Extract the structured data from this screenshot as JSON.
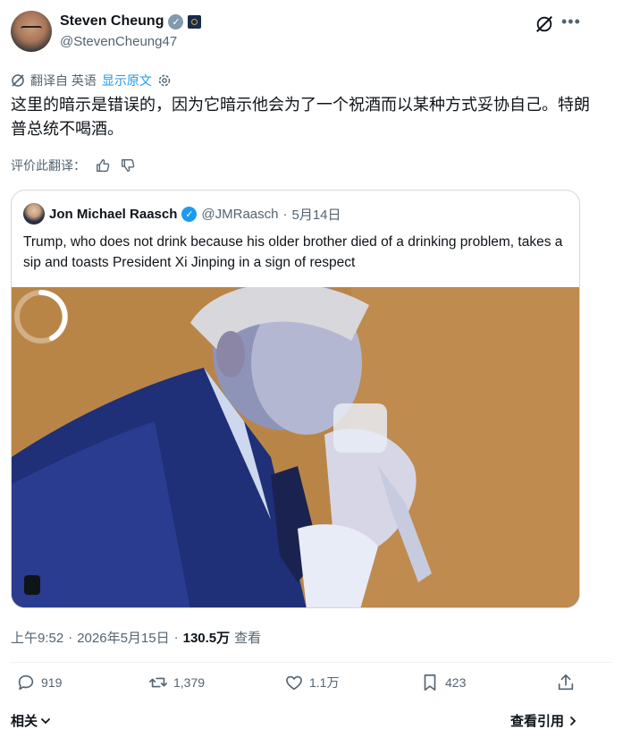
{
  "author": {
    "display_name": "Steven Cheung",
    "handle": "@StevenCheung47",
    "avatar_icon": "person-avatar",
    "verified_icon": "verified-gray-badge",
    "affiliation_icon": "government-seal-badge"
  },
  "translation": {
    "label": "翻译自 英语",
    "show_original": "显示原文",
    "text": "这里的暗示是错误的，因为它暗示他会为了一个祝酒而以某种方式妥协自己。特朗普总统不喝酒。",
    "rate_label": "评价此翻译："
  },
  "quote": {
    "display_name": "Jon Michael Raasch",
    "handle": "@JMRaasch",
    "separator": "·",
    "date": "5月14日",
    "text": "Trump, who does not drink because his older brother died of a drinking problem, takes a sip and toasts President Xi Jinping in a sign of respect",
    "verified_icon": "verified-blue-badge",
    "media_state": "loading"
  },
  "meta": {
    "time": "上午9:52",
    "separator1": "·",
    "date": "2026年5月15日",
    "separator2": "·",
    "views_count": "130.5万",
    "views_label": "查看"
  },
  "actions": {
    "replies": "919",
    "reposts": "1,379",
    "likes": "1.1万",
    "bookmarks": "423"
  },
  "footer": {
    "related": "相关",
    "view_quotes": "查看引用"
  },
  "colors": {
    "accent": "#1d9bf0",
    "text_primary": "#0f1419",
    "text_secondary": "#536471",
    "border": "#cfd9de"
  }
}
